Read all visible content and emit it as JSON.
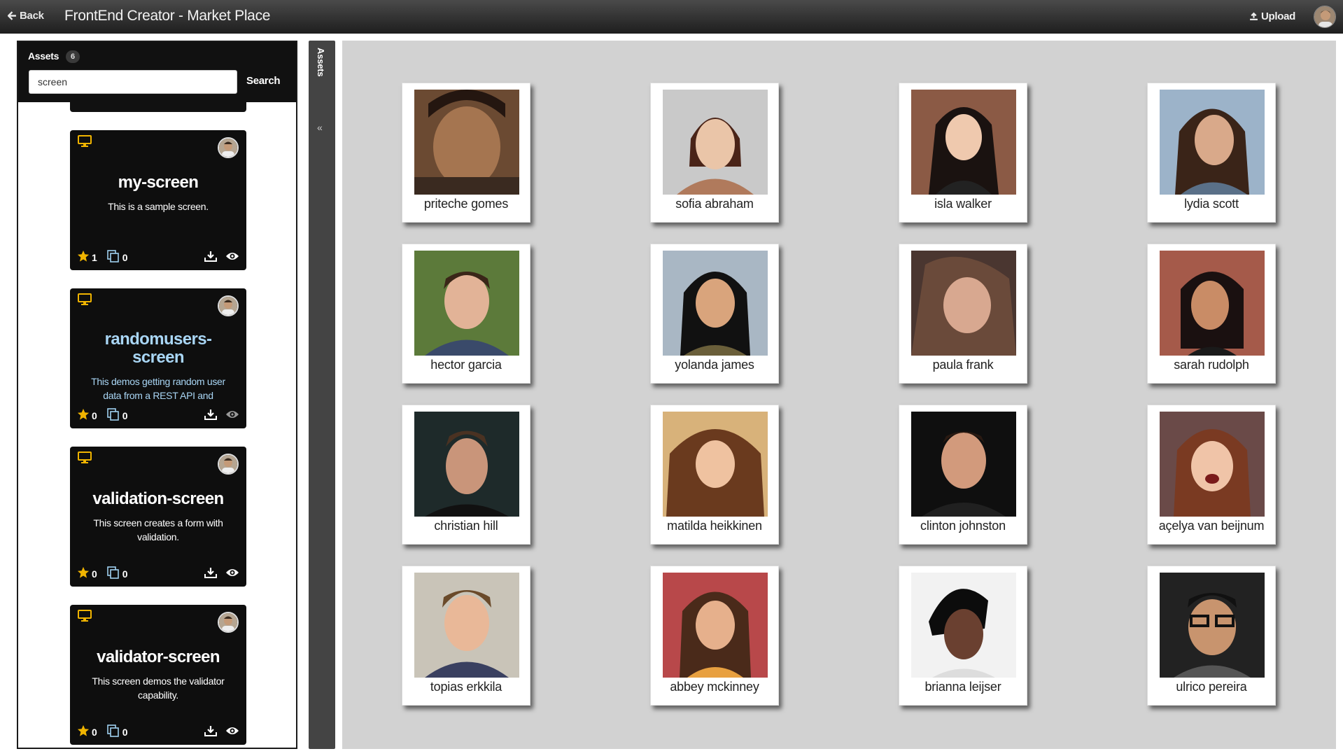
{
  "topbar": {
    "back_label": "Back",
    "title": "FrontEnd Creator - Market Place",
    "upload_label": "Upload"
  },
  "assets_panel": {
    "label": "Assets",
    "count": "6",
    "search_value": "screen",
    "search_button": "Search",
    "collapse_label": "Assets",
    "collapse_icon": "«",
    "cards": [
      {
        "title": "my-screen",
        "description": "This is a sample screen.",
        "stars": "1",
        "copies": "0",
        "highlight": false
      },
      {
        "title": "randomusers-screen",
        "description": "This demos getting random user data from a REST API and",
        "stars": "0",
        "copies": "0",
        "highlight": true
      },
      {
        "title": "validation-screen",
        "description": "This screen creates a form with validation.",
        "stars": "0",
        "copies": "0",
        "highlight": false
      },
      {
        "title": "validator-screen",
        "description": "This screen demos the validator capability.",
        "stars": "0",
        "copies": "0",
        "highlight": false
      }
    ]
  },
  "people": [
    {
      "name": "priteche gomes"
    },
    {
      "name": "sofia abraham"
    },
    {
      "name": "isla walker"
    },
    {
      "name": "lydia scott"
    },
    {
      "name": "hector garcia"
    },
    {
      "name": "yolanda james"
    },
    {
      "name": "paula frank"
    },
    {
      "name": "sarah rudolph"
    },
    {
      "name": "christian hill"
    },
    {
      "name": "matilda heikkinen"
    },
    {
      "name": "clinton johnston"
    },
    {
      "name": "açelya van beijnum"
    },
    {
      "name": "topias erkkila"
    },
    {
      "name": "abbey mckinney"
    },
    {
      "name": "brianna leijser"
    },
    {
      "name": "ulrico pereira"
    }
  ],
  "colors": {
    "accent_yellow": "#f0b400",
    "link_blue": "#a9d6f5",
    "panel_bg": "#d2d2d2"
  }
}
